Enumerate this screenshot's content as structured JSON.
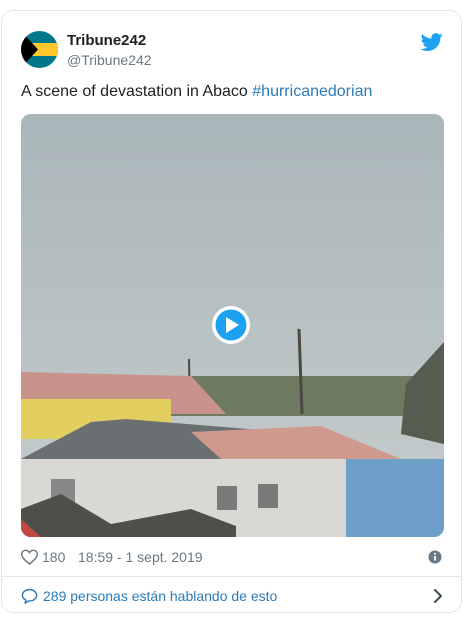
{
  "tweet": {
    "author_name": "Tribune242",
    "author_handle": "@Tribune242",
    "text_plain": "A scene of devastation in Abaco ",
    "hashtag": "#hurricanedorian",
    "likes": "180",
    "timestamp": "18:59 - 1 sept. 2019",
    "conversation_label": "289 personas están hablando de esto"
  },
  "icons": {
    "platform": "twitter-bird-icon",
    "like": "heart-icon",
    "info": "info-icon",
    "conversation": "chat-bubble-icon",
    "open": "chevron-right-icon",
    "play": "play-icon"
  },
  "colors": {
    "brand": "#1da1f2",
    "link": "#2b7bb9",
    "secondary_text": "#697882",
    "border": "#e1e8ed"
  }
}
